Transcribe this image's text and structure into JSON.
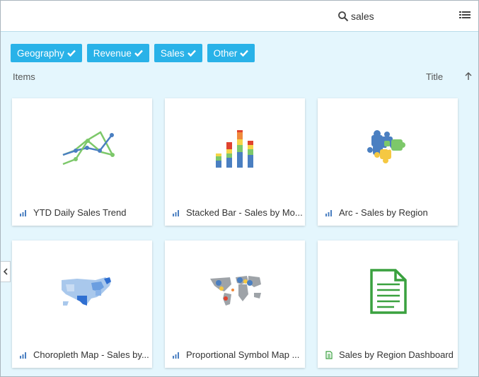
{
  "search": {
    "value": "sales"
  },
  "filters": [
    {
      "label": "Geography"
    },
    {
      "label": "Revenue"
    },
    {
      "label": "Sales"
    },
    {
      "label": "Other"
    }
  ],
  "list_header": {
    "items_label": "Items",
    "sort_label": "Title"
  },
  "cards": [
    {
      "title": "YTD Daily Sales Trend",
      "type_icon": "chart-icon"
    },
    {
      "title": "Stacked Bar - Sales by Mo...",
      "type_icon": "chart-icon"
    },
    {
      "title": "Arc - Sales by Region",
      "type_icon": "chart-icon"
    },
    {
      "title": "Choropleth Map - Sales by...",
      "type_icon": "chart-icon"
    },
    {
      "title": "Proportional Symbol Map ...",
      "type_icon": "chart-icon"
    },
    {
      "title": "Sales by Region Dashboard",
      "type_icon": "dashboard-icon"
    }
  ],
  "colors": {
    "accent": "#29b2e8",
    "background": "#e4f6fd",
    "chart_blue": "#4a7fc1",
    "chart_green": "#7dc86a",
    "dashboard_green": "#3aa13f"
  }
}
